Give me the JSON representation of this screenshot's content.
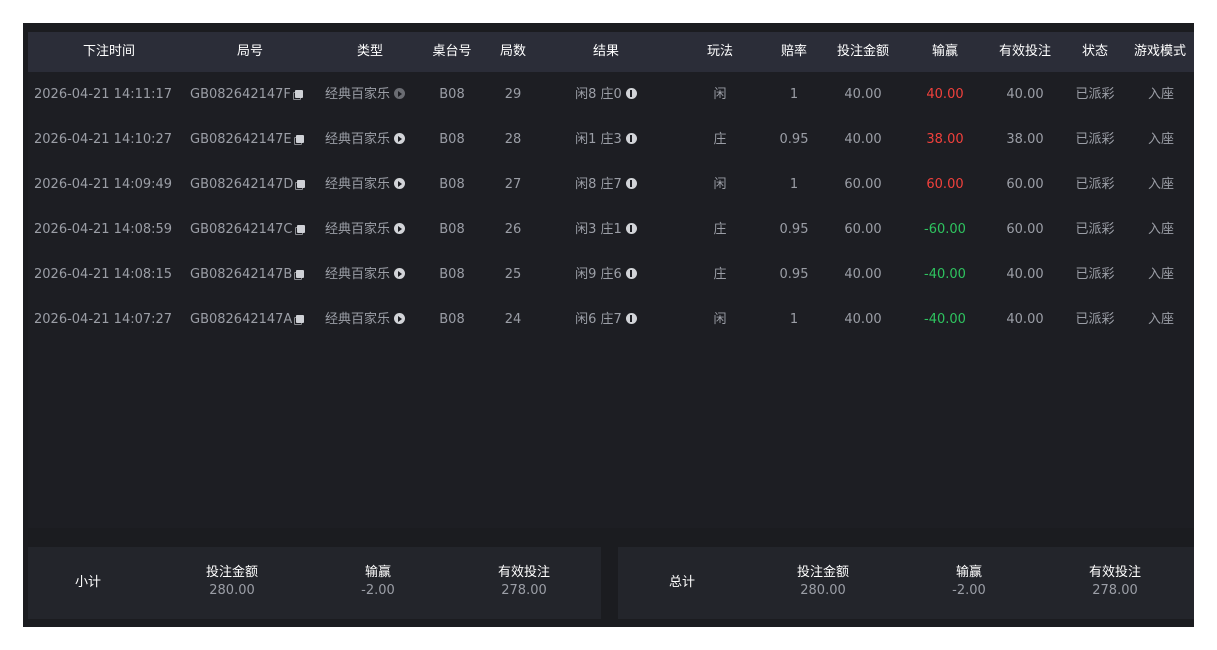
{
  "columns": [
    "下注时间",
    "局号",
    "类型",
    "桌台号",
    "局数",
    "结果",
    "玩法",
    "赔率",
    "投注金额",
    "输赢",
    "有效投注",
    "状态",
    "游戏模式"
  ],
  "rows": [
    {
      "time": "2026-04-21 14:11:17",
      "round_id": "GB082642147F",
      "type": "经典百家乐",
      "table": "B08",
      "round": "29",
      "result": "闲8 庄0",
      "play": "闲",
      "odds": "1",
      "bet": "40.00",
      "win": "40.00",
      "win_status": "red",
      "valid": "40.00",
      "status": "已派彩",
      "mode": "入座"
    },
    {
      "time": "2026-04-21 14:10:27",
      "round_id": "GB082642147E",
      "type": "经典百家乐",
      "table": "B08",
      "round": "28",
      "result": "闲1 庄3",
      "play": "庄",
      "odds": "0.95",
      "bet": "40.00",
      "win": "38.00",
      "win_status": "red",
      "valid": "38.00",
      "status": "已派彩",
      "mode": "入座"
    },
    {
      "time": "2026-04-21 14:09:49",
      "round_id": "GB082642147D",
      "type": "经典百家乐",
      "table": "B08",
      "round": "27",
      "result": "闲8 庄7",
      "play": "闲",
      "odds": "1",
      "bet": "60.00",
      "win": "60.00",
      "win_status": "red",
      "valid": "60.00",
      "status": "已派彩",
      "mode": "入座"
    },
    {
      "time": "2026-04-21 14:08:59",
      "round_id": "GB082642147C",
      "type": "经典百家乐",
      "table": "B08",
      "round": "26",
      "result": "闲3 庄1",
      "play": "庄",
      "odds": "0.95",
      "bet": "60.00",
      "win": "-60.00",
      "win_status": "green",
      "valid": "60.00",
      "status": "已派彩",
      "mode": "入座"
    },
    {
      "time": "2026-04-21 14:08:15",
      "round_id": "GB082642147B",
      "type": "经典百家乐",
      "table": "B08",
      "round": "25",
      "result": "闲9 庄6",
      "play": "庄",
      "odds": "0.95",
      "bet": "40.00",
      "win": "-40.00",
      "win_status": "green",
      "valid": "40.00",
      "status": "已派彩",
      "mode": "入座"
    },
    {
      "time": "2026-04-21 14:07:27",
      "round_id": "GB082642147A",
      "type": "经典百家乐",
      "table": "B08",
      "round": "24",
      "result": "闲6 庄7",
      "play": "闲",
      "odds": "1",
      "bet": "40.00",
      "win": "-40.00",
      "win_status": "green",
      "valid": "40.00",
      "status": "已派彩",
      "mode": "入座"
    }
  ],
  "subtotal": {
    "title": "小计",
    "bet_label": "投注金额",
    "bet": "280.00",
    "win_label": "输赢",
    "win": "-2.00",
    "valid_label": "有效投注",
    "valid": "278.00"
  },
  "total": {
    "title": "总计",
    "bet_label": "投注金额",
    "bet": "280.00",
    "win_label": "输赢",
    "win": "-2.00",
    "valid_label": "有效投注",
    "valid": "278.00"
  },
  "icons": {
    "copy": "copy-icon",
    "video": "play-video-icon",
    "info": "info-icon"
  },
  "colors": {
    "win_positive": "#f0403c",
    "win_negative": "#2ec35f",
    "header_bg": "#2b2d38",
    "panel_bg": "#1d1e23"
  }
}
